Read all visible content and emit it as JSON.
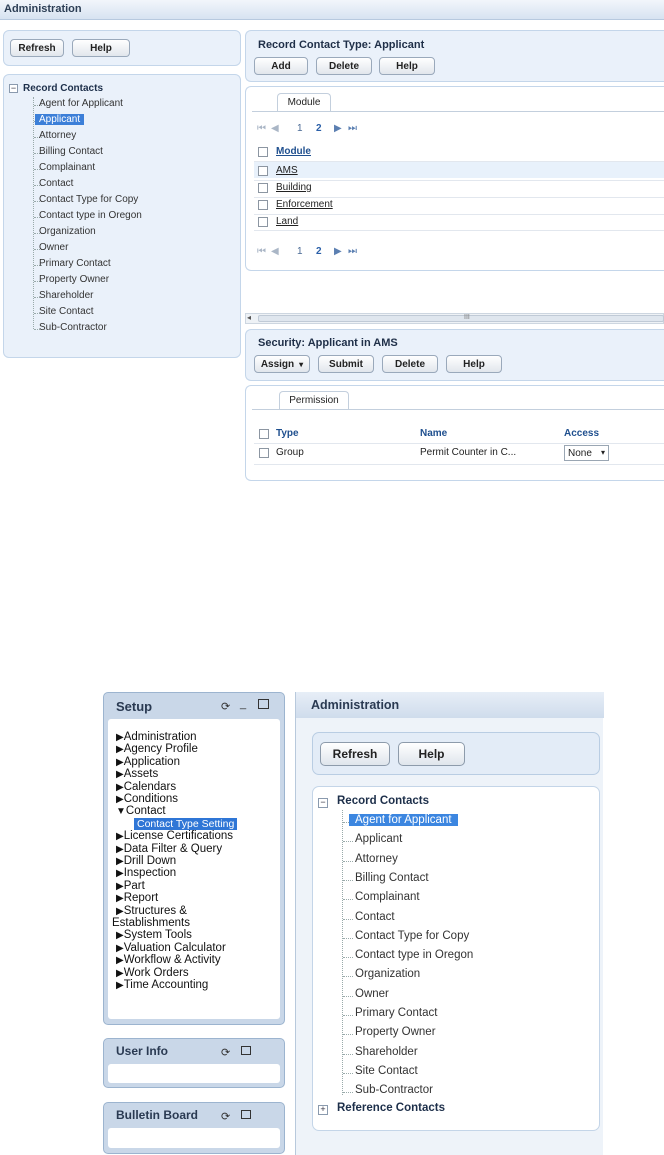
{
  "top": {
    "window_title": "Administration",
    "left_toolbar": {
      "refresh": "Refresh",
      "help": "Help"
    },
    "tree": {
      "root": "Record Contacts",
      "items": [
        "Agent for Applicant",
        "Applicant",
        "Attorney",
        "Billing Contact",
        "Complainant",
        "Contact",
        "Contact Type for Copy",
        "Contact type in Oregon",
        "Organization",
        "Owner",
        "Primary Contact",
        "Property Owner",
        "Shareholder",
        "Site Contact",
        "Sub-Contractor"
      ],
      "selected": "Applicant"
    },
    "record_panel": {
      "title": "Record Contact Type: Applicant",
      "buttons": {
        "add": "Add",
        "delete": "Delete",
        "help": "Help"
      },
      "tab": "Module",
      "pager": {
        "page1": "1",
        "page2": "2"
      },
      "column": "Module",
      "rows": [
        "AMS",
        "Building",
        "Enforcement",
        "Land"
      ]
    },
    "security_panel": {
      "title": "Security: Applicant in AMS",
      "buttons": {
        "assign": "Assign",
        "submit": "Submit",
        "delete": "Delete",
        "help": "Help"
      },
      "tab": "Permission",
      "columns": {
        "type": "Type",
        "name": "Name",
        "access": "Access"
      },
      "row": {
        "type": "Group",
        "name": "Permit Counter in C...",
        "access": "None"
      }
    },
    "scroll_mark": "III"
  },
  "bottom": {
    "setup": {
      "title": "Setup",
      "items": [
        "Administration",
        "Agency Profile",
        "Application",
        "Assets",
        "Calendars",
        "Conditions",
        "Contact"
      ],
      "sub_item": "Contact Type Setting",
      "items_after": [
        "License Certifications",
        "Data Filter & Query",
        "Drill Down",
        "Inspection",
        "Part",
        "Report",
        "Structures &",
        "Establishments",
        "System Tools",
        "Valuation Calculator",
        "Workflow & Activity",
        "Work Orders",
        "Time Accounting"
      ]
    },
    "user_info": {
      "title": "User Info"
    },
    "bulletin": {
      "title": "Bulletin Board"
    },
    "admin": {
      "title": "Administration",
      "buttons": {
        "refresh": "Refresh",
        "help": "Help"
      },
      "root": "Record Contacts",
      "items": [
        "Agent for Applicant",
        "Applicant",
        "Attorney",
        "Billing Contact",
        "Complainant",
        "Contact",
        "Contact Type for Copy",
        "Contact type in Oregon",
        "Organization",
        "Owner",
        "Primary Contact",
        "Property Owner",
        "Shareholder",
        "Site Contact",
        "Sub-Contractor"
      ],
      "selected": "Agent for Applicant",
      "root2": "Reference Contacts"
    }
  }
}
